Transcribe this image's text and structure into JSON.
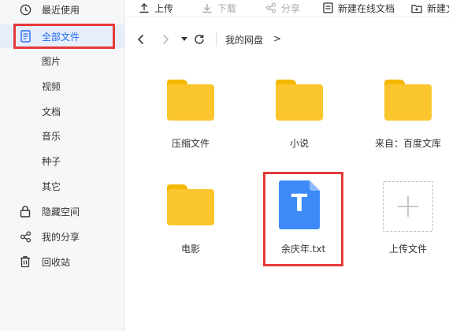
{
  "sidebar": {
    "items": [
      {
        "label": "最近使用",
        "icon": "clock-icon"
      },
      {
        "label": "全部文件",
        "icon": "document-icon",
        "active": true
      },
      {
        "label": "图片"
      },
      {
        "label": "视频"
      },
      {
        "label": "文档"
      },
      {
        "label": "音乐"
      },
      {
        "label": "种子"
      },
      {
        "label": "其它"
      },
      {
        "label": "隐藏空间",
        "icon": "lock-icon"
      },
      {
        "label": "我的分享",
        "icon": "share-icon"
      },
      {
        "label": "回收站",
        "icon": "trash-icon"
      }
    ]
  },
  "toolbar": {
    "upload": "上传",
    "download": "下载",
    "share": "分享",
    "new_online_doc": "新建在线文档",
    "new_folder": "新建文"
  },
  "address": {
    "crumb": "我的网盘",
    "crumb_sep": ">"
  },
  "files": [
    {
      "name": "压缩文件",
      "type": "folder"
    },
    {
      "name": "小说",
      "type": "folder"
    },
    {
      "name": "来自：百度文库",
      "type": "folder"
    },
    {
      "name": "电影",
      "type": "folder"
    },
    {
      "name": "余庆年.txt",
      "type": "txt"
    },
    {
      "name": "上传文件",
      "type": "upload"
    }
  ],
  "doc_glyph": "T",
  "colors": {
    "accent": "#2468f2",
    "highlight": "#e53a3a",
    "folder": "#fbc52d",
    "txt_icon": "#3d8af7"
  }
}
